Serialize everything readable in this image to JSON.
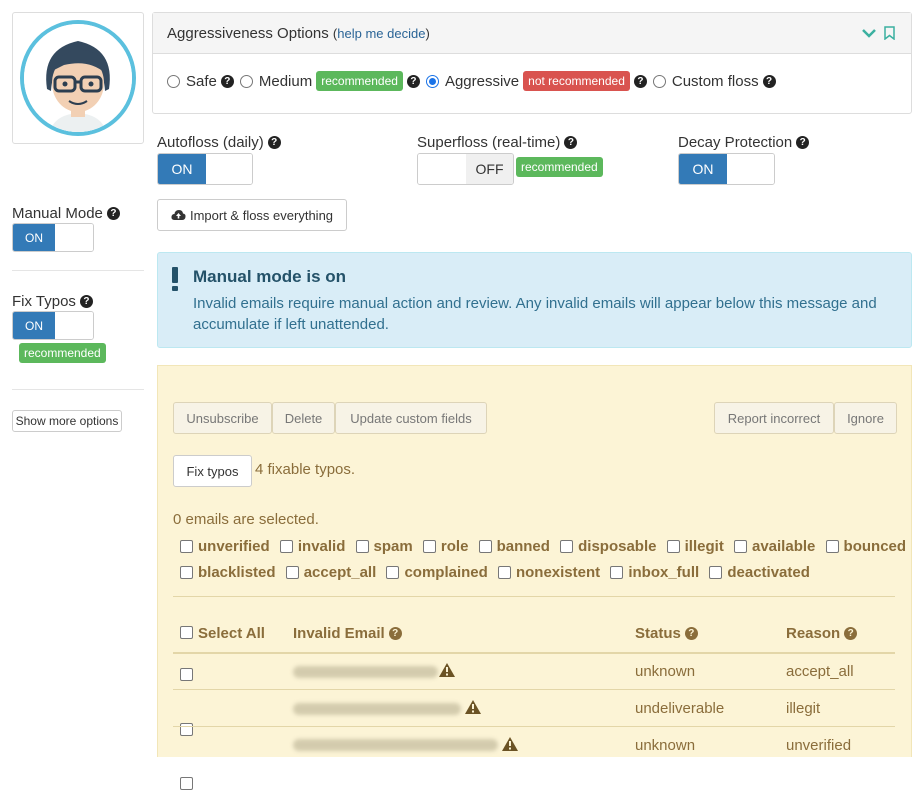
{
  "aggressiveness": {
    "title": "Aggressiveness Options",
    "help_link": "help me decide",
    "options": [
      {
        "label": "Safe",
        "selected": false
      },
      {
        "label": "Medium",
        "badge": "recommended",
        "selected": false
      },
      {
        "label": "Aggressive",
        "badge": "not recommended",
        "selected": true
      },
      {
        "label": "Custom floss",
        "selected": false
      }
    ]
  },
  "toggles": {
    "autofloss": {
      "label": "Autofloss (daily)",
      "state": "ON"
    },
    "superfloss": {
      "label": "Superfloss (real-time)",
      "state": "OFF",
      "badge": "recommended"
    },
    "decay": {
      "label": "Decay Protection",
      "state": "ON"
    },
    "manual_mode": {
      "label": "Manual Mode",
      "state": "ON"
    },
    "fix_typos": {
      "label": "Fix Typos",
      "state": "ON",
      "badge": "recommended"
    }
  },
  "import_button": "Import & floss everything",
  "show_more": "Show more options",
  "alert": {
    "title": "Manual mode is on",
    "text": "Invalid emails require manual action and review. Any invalid emails will appear below this message and accumulate if left unattended."
  },
  "actions": {
    "unsubscribe": "Unsubscribe",
    "delete": "Delete",
    "update_custom_fields": "Update custom fields",
    "report_incorrect": "Report incorrect",
    "ignore": "Ignore",
    "fix_typos": "Fix typos",
    "fixable": "4 fixable typos."
  },
  "selected_count": "0 emails are selected.",
  "filters_row1": [
    "unverified",
    "invalid",
    "spam",
    "role",
    "banned",
    "disposable",
    "illegit",
    "available",
    "bounced"
  ],
  "filters_row2": [
    "blacklisted",
    "accept_all",
    "complained",
    "nonexistent",
    "inbox_full",
    "deactivated"
  ],
  "table": {
    "headers": {
      "select_all": "Select All",
      "email": "Invalid Email",
      "status": "Status",
      "reason": "Reason"
    },
    "rows": [
      {
        "status": "unknown",
        "reason": "accept_all"
      },
      {
        "status": "undeliverable",
        "reason": "illegit"
      },
      {
        "status": "unknown",
        "reason": "unverified"
      }
    ]
  },
  "colors": {
    "primary": "#337ab7",
    "success": "#5cb85c",
    "danger": "#d9534f",
    "info_bg": "#d9edf7",
    "warning_bg": "#fcf4d6",
    "warning_text": "#8a6d3b"
  }
}
